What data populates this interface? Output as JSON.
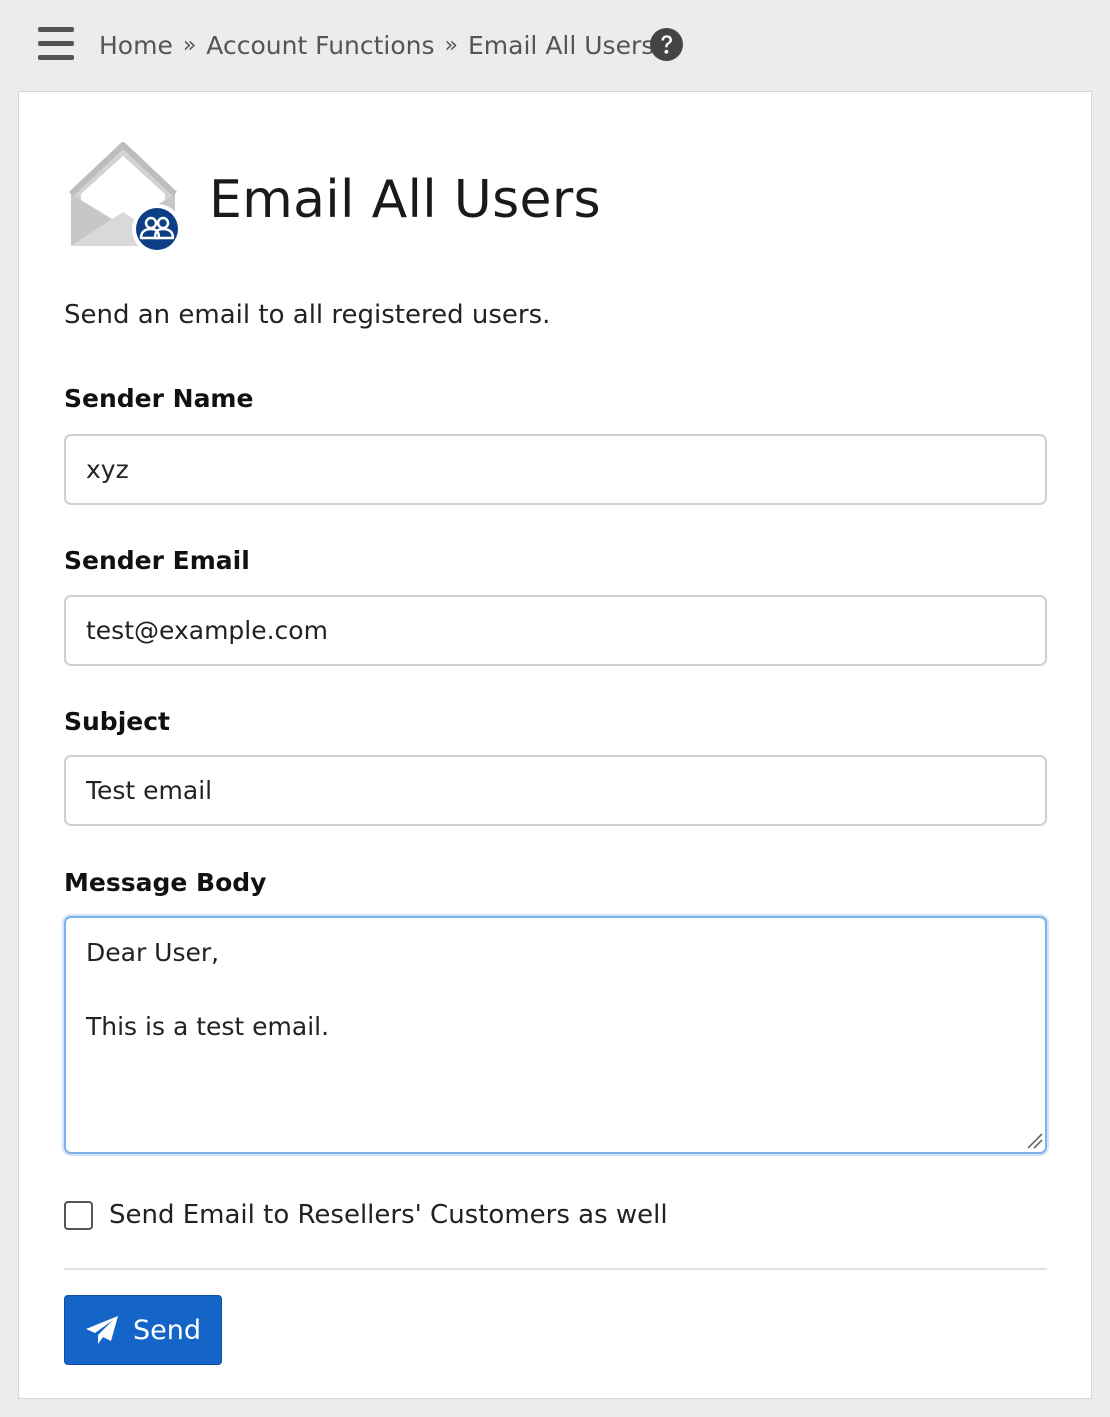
{
  "breadcrumb": {
    "home": "Home",
    "separator": "»",
    "section": "Account Functions",
    "current": "Email All Users"
  },
  "page": {
    "title": "Email All Users",
    "intro": "Send an email to all registered users."
  },
  "form": {
    "sender_name": {
      "label": "Sender Name",
      "value": "xyz"
    },
    "sender_email": {
      "label": "Sender Email",
      "value": "test@example.com"
    },
    "subject": {
      "label": "Subject",
      "value": "Test email"
    },
    "message_body": {
      "label": "Message Body",
      "value": "Dear User,\n\nThis is a test email."
    },
    "resellers_checkbox": {
      "label": "Send Email to Resellers' Customers as well",
      "checked": false
    },
    "send_label": "Send"
  },
  "icons": {
    "menu": "hamburger-menu-icon",
    "help": "question-circle-icon",
    "title": "envelope-users-icon",
    "send": "paper-plane-icon"
  },
  "colors": {
    "primary": "#1565c8",
    "badge": "#0d3f87",
    "focus_border": "#7fb2e8"
  }
}
